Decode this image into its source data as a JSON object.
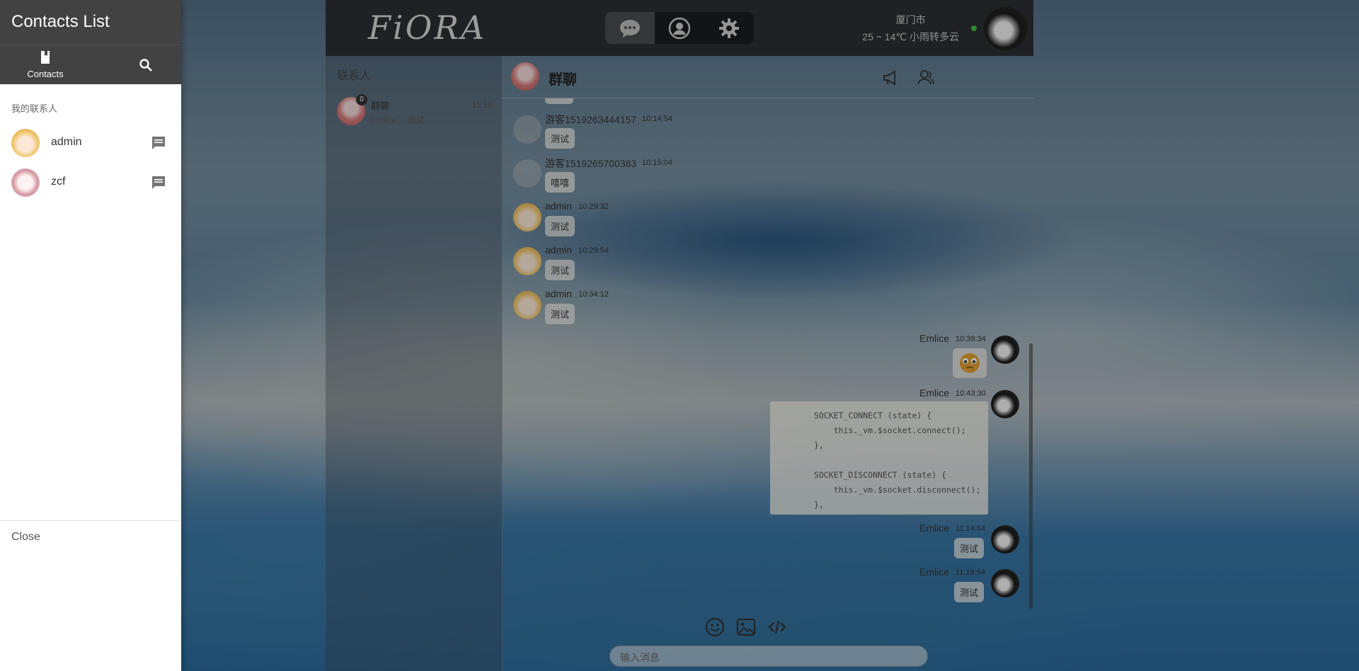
{
  "app": {
    "logo": "FiORA",
    "weather_city": "厦门市",
    "weather_text": "25 ~ 14℃ 小雨转多云"
  },
  "nav": {
    "icons": [
      "chat-icon",
      "profile-icon",
      "settings-icon"
    ]
  },
  "contacts_pane": {
    "title": "联系人",
    "conversation": {
      "name": "群聊",
      "time": "11:18",
      "last_message": "Emlice： 测试",
      "badge": "0"
    }
  },
  "chat": {
    "group_name": "群聊",
    "messages": [
      {
        "name": "游客1519263444157",
        "time": "10:14:54",
        "text": "测试"
      },
      {
        "name": "游客1519265700383",
        "time": "10:15:04",
        "text": "嘻嘻"
      },
      {
        "name": "admin",
        "time": "10:29:32",
        "text": "测试"
      },
      {
        "name": "admin",
        "time": "10:29:54",
        "text": "测试"
      },
      {
        "name": "admin",
        "time": "10:34:12",
        "text": "测试"
      },
      {
        "name": "Emlice",
        "time": "10:39:34",
        "text": ""
      },
      {
        "name": "Emlice",
        "time": "10:43:30",
        "code": "SOCKET_CONNECT (state) {\n    this._vm.$socket.connect();\n},\n\nSOCKET_DISCONNECT (state) {\n    this._vm.$socket.disconnect();\n},"
      },
      {
        "name": "Emlice",
        "time": "11:14:54",
        "text": "测试"
      },
      {
        "name": "Emlice",
        "time": "11:18:54",
        "text": "测试"
      }
    ],
    "input_placeholder": "输入消息"
  },
  "drawer": {
    "title": "Contacts List",
    "tabs": [
      {
        "label": "Contacts",
        "icon": "book-icon"
      },
      {
        "label": "",
        "icon": "search-icon"
      }
    ],
    "section_label": "我的联系人",
    "contacts": [
      {
        "name": "admin"
      },
      {
        "name": "zcf"
      }
    ],
    "close_label": "Close"
  }
}
